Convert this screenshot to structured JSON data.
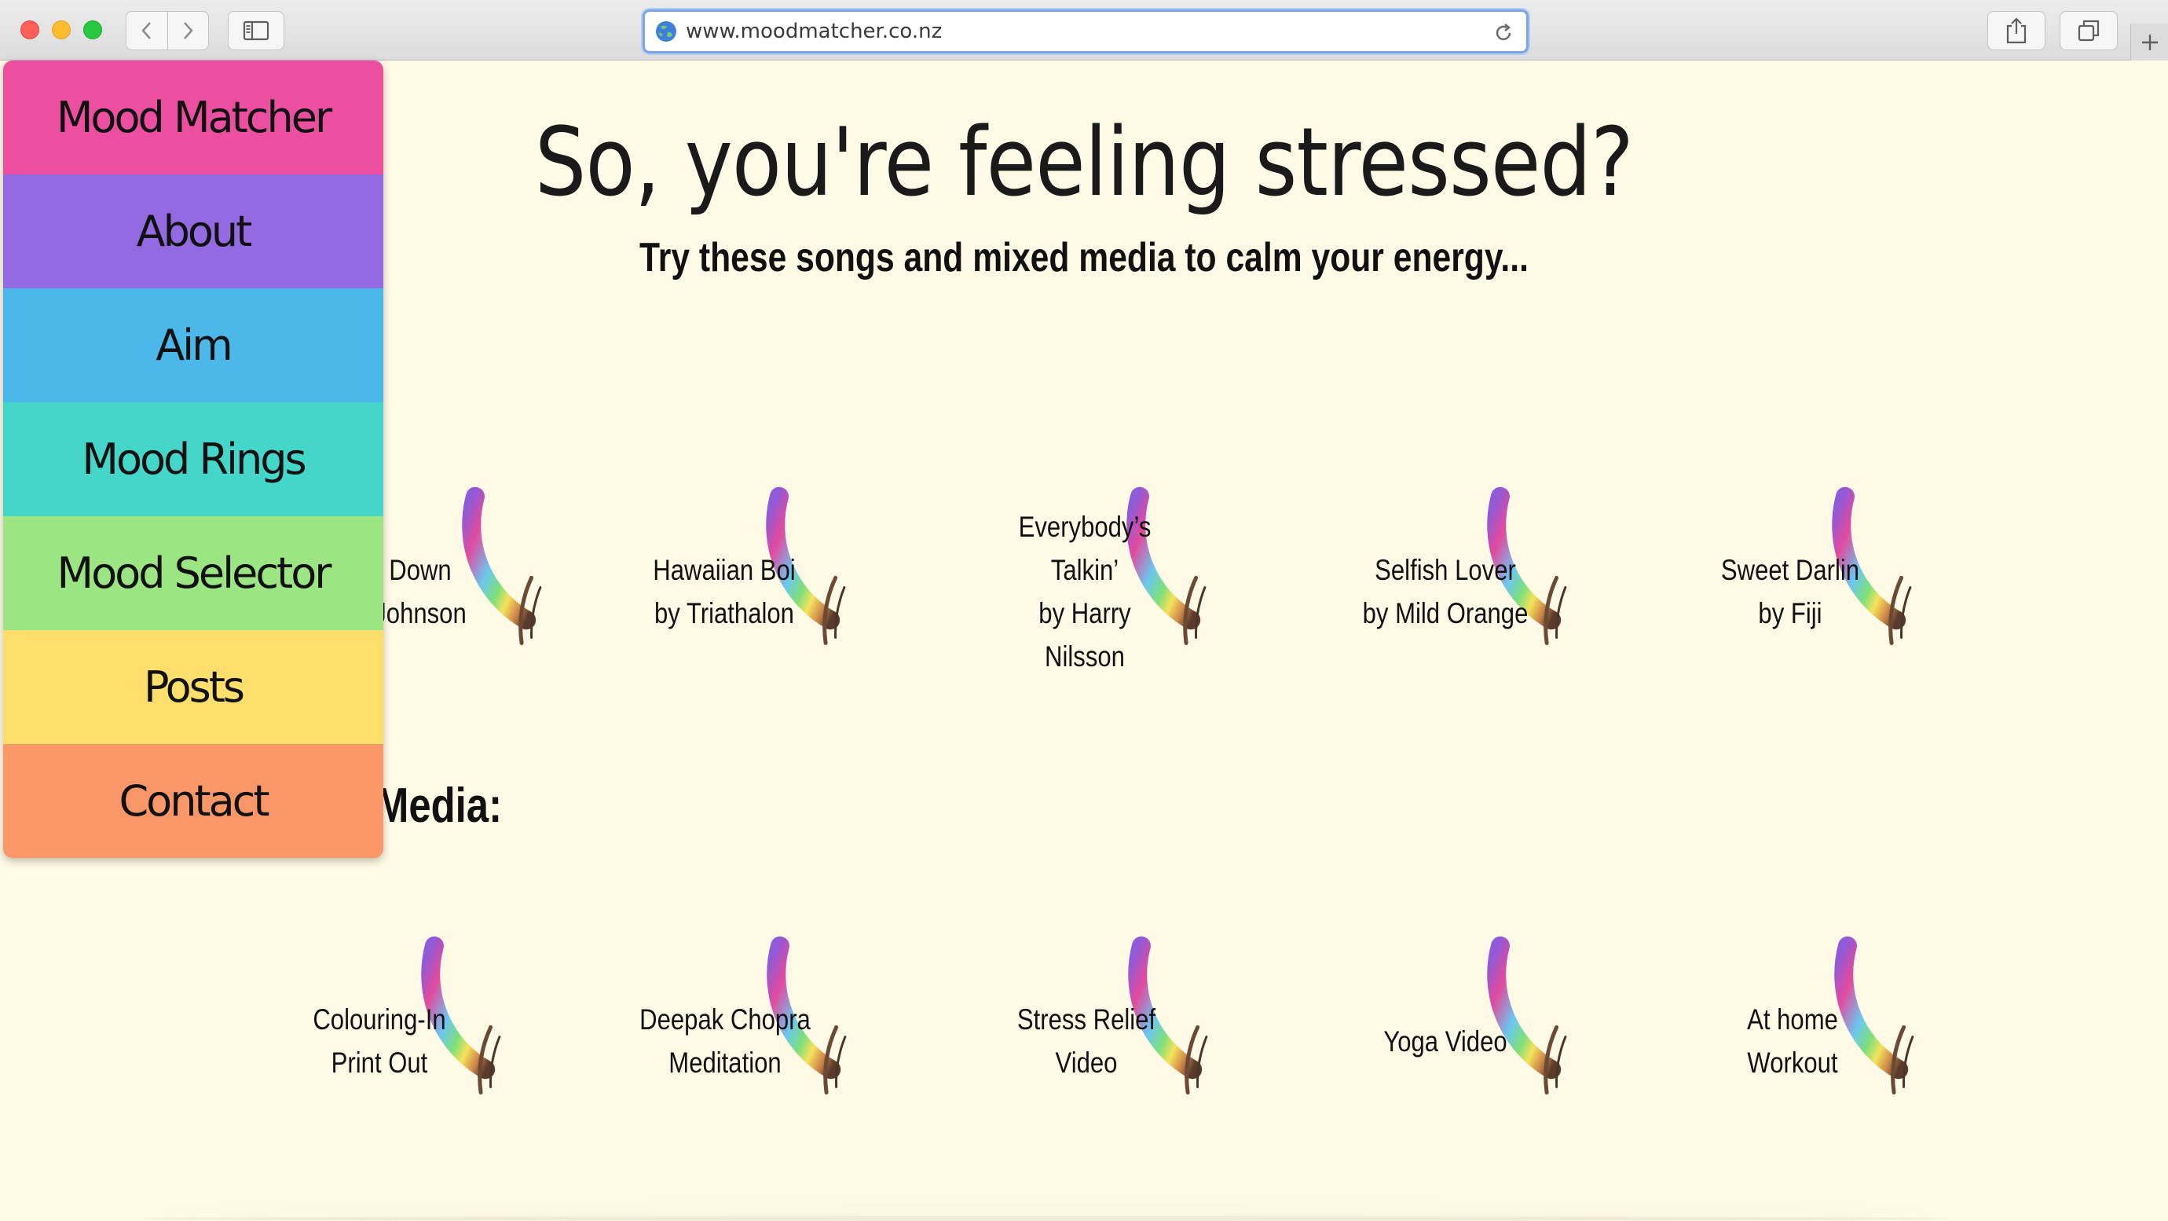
{
  "browser": {
    "url": "www.moodmatcher.co.nz",
    "icons": [
      "back-icon",
      "forward-icon",
      "sidebar-icon",
      "globe-icon",
      "reload-icon",
      "share-icon",
      "tabs-icon",
      "plus-icon"
    ]
  },
  "menu": {
    "items": [
      {
        "label": "Mood Matcher",
        "color": "#ec4f9f"
      },
      {
        "label": "About",
        "color": "#936ae2"
      },
      {
        "label": "Aim",
        "color": "#4cb8ea"
      },
      {
        "label": "Mood Rings",
        "color": "#44d6c9"
      },
      {
        "label": "Mood Selector",
        "color": "#9be683"
      },
      {
        "label": "Posts",
        "color": "#ffdf6b"
      },
      {
        "label": "Contact",
        "color": "#f99768"
      }
    ]
  },
  "main": {
    "title": "So, you're feeling stressed?",
    "subtitle": "Try these songs and mixed media to calm your energy...",
    "media_section_label": "Media:",
    "songs": [
      {
        "line1": "Down",
        "line2": "Johnson"
      },
      {
        "line1": "Hawaiian  Boi",
        "line2": "by Triathalon"
      },
      {
        "line1": "Everybody’s Talkin’",
        "line2": "by Harry Nilsson"
      },
      {
        "line1": "Selfish Lover",
        "line2": "by Mild Orange"
      },
      {
        "line1": "Sweet Darlin",
        "line2": "by Fiji"
      }
    ],
    "media": [
      {
        "line1": "Colouring-In",
        "line2": "Print Out"
      },
      {
        "line1": "Deepak Chopra",
        "line2": "Meditation"
      },
      {
        "line1": "Stress Relief",
        "line2": "Video"
      },
      {
        "line1": "Yoga Video",
        "line2": ""
      },
      {
        "line1": "At home",
        "line2": "Workout"
      }
    ]
  },
  "colors": {
    "page_background": "#fffae6",
    "ring_gradient": [
      "#8f5bd9",
      "#e24a9e",
      "#f3639a",
      "#6cc7f0",
      "#7de07a",
      "#f6e25b",
      "#d08a4a",
      "#5a3a2a"
    ]
  }
}
